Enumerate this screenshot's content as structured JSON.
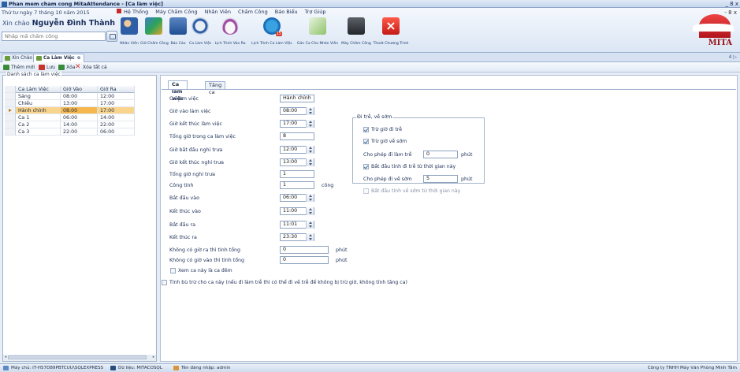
{
  "window": {
    "title": "Phan mem cham cong MitaAttendance - [Ca làm việc]",
    "controls": "_ 8 x"
  },
  "sidebar": {
    "date": "Thứ tư ngày 7 tháng 10 năm 2015",
    "greeting": "Xin chào",
    "username": "Nguyễn Đình Thành",
    "search_placeholder": "Nhập mã chấm công"
  },
  "menu": [
    "Hệ Thống",
    "Máy Chấm Công",
    "Nhân Viên",
    "Chấm Công",
    "Báo Biểu",
    "Trợ Giúp"
  ],
  "mdi_controls": "- 8 x",
  "toolbar": [
    {
      "label": "Nhân Viên",
      "icon": "employee-icon"
    },
    {
      "label": "Giờ Chấm Công",
      "icon": "attendance-icon"
    },
    {
      "label": "Báo Cáo",
      "icon": "report-icon"
    },
    {
      "label": "Ca Làm Việc",
      "icon": "shift-icon"
    },
    {
      "label": "Lịch Trình Vào Ra",
      "icon": "schedule-icon"
    },
    {
      "label": "Lịch Trình Ca Làm Việc",
      "icon": "calendar-icon"
    },
    {
      "label": "Gán Ca Cho Nhân Viên",
      "icon": "assign-icon"
    },
    {
      "label": "Máy Chấm Công",
      "icon": "machine-icon"
    },
    {
      "label": "Thoát Chương Trình",
      "icon": "exit-icon"
    }
  ],
  "calendar_badge": "15",
  "brand": "MITA",
  "doc_tabs": [
    {
      "label": "Xin Chào"
    },
    {
      "label": "Ca Làm Việc"
    }
  ],
  "nav_arrows": "4 ▷",
  "actions": [
    {
      "label": "Thêm mới"
    },
    {
      "label": "Lưu"
    },
    {
      "label": "Xóa"
    },
    {
      "label": "Xóa tất cả"
    }
  ],
  "shift_list": {
    "caption": "Danh sách ca làm việc",
    "columns": [
      "Ca Làm Việc",
      "Giờ Vào",
      "Giờ Ra"
    ],
    "rows": [
      [
        "Sáng",
        "08:00",
        "12:00"
      ],
      [
        "Chiều",
        "13:00",
        "17:00"
      ],
      [
        "Hành chính",
        "08:00",
        "17:00"
      ],
      [
        "Ca 1",
        "06:00",
        "14:00"
      ],
      [
        "Ca 2",
        "14:00",
        "22:00"
      ],
      [
        "Ca 3",
        "22:00",
        "06:00"
      ]
    ],
    "selected_index": 2
  },
  "form_tabs": [
    "Ca làm việc",
    "Tăng ca"
  ],
  "form": {
    "shift_name_label": "Ca làm việc",
    "shift_name": "Hành chính",
    "start_label": "Giờ vào làm việc",
    "start": "08:00",
    "end_label": "Giờ kết thúc làm việc",
    "end": "17:00",
    "total_label": "Tổng giờ trong ca làm việc",
    "total": "8",
    "break_start_label": "Giờ bắt đầu nghỉ trưa",
    "break_start": "12:00",
    "break_end_label": "Giờ kết thúc nghỉ trưa",
    "break_end": "13:00",
    "break_total_label": "Tổng giờ nghỉ trưa",
    "break_total": "1",
    "workday_label": "Công tính",
    "workday": "1",
    "workday_unit": "công",
    "in_from_label": "Bắt đầu vào",
    "in_from": "06:00",
    "in_to_label": "Kết thúc vào",
    "in_to": "11:00",
    "out_from_label": "Bắt đầu ra",
    "out_from": "11:01",
    "out_to_label": "Kết thúc ra",
    "out_to": "23:30",
    "no_out_label": "Không có giờ ra thì tính tổng",
    "no_out": "0",
    "no_in_label": "Không có giờ vào thì tính tổng",
    "no_in": "0",
    "minute_unit": "phút",
    "night_shift_label": "Xem ca này là ca đêm",
    "compensate_label": "Tính bù trừ cho ca này (nếu đi làm trễ thì có thể đi về trễ để không bị trừ giờ, không tính tăng ca)"
  },
  "late_early": {
    "caption": "Đi trễ, về sớm",
    "deduct_late": "Trừ giờ đi trễ",
    "deduct_early": "Trừ giờ về sớm",
    "allow_late_label": "Cho phép đi làm trễ",
    "allow_late": "0",
    "late_from_break": "Bắt đầu tính đi trễ từ thời gian này",
    "allow_early_label": "Cho phép đi về sớm",
    "allow_early": "5",
    "early_from_break": "Bắt đầu tính về sớm từ thời gian này",
    "minute_unit": "phút"
  },
  "status": {
    "server": "Máy chủ: IT-H57D89PBTCUU\\SQLEXPRESS",
    "database": "Dữ liệu: MITACOSQL",
    "login": "Tên đăng nhập: admin",
    "company": "Công ty TNHH Máy Văn Phòng Minh Tâm"
  }
}
